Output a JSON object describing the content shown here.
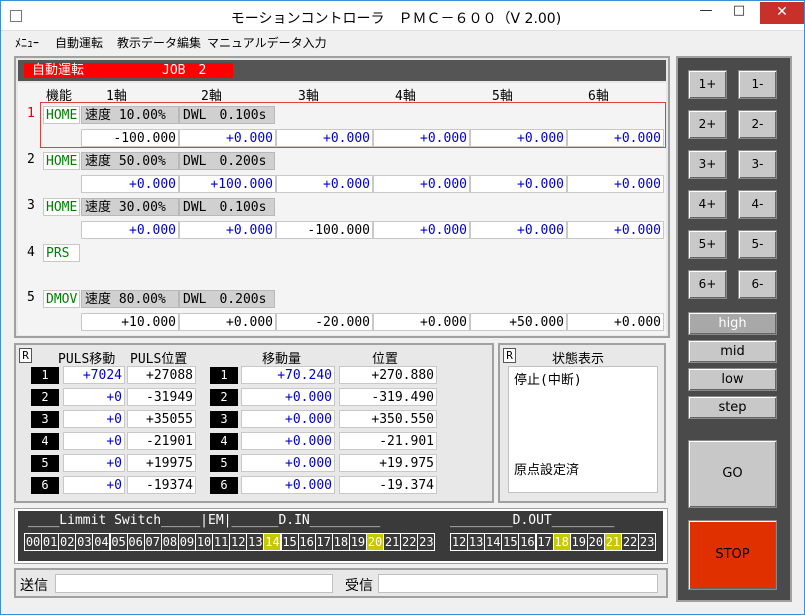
{
  "title": "モーションコントローラ　ＰＭＣ－６００（V 2.00)",
  "titlebar": {
    "minimize": "—",
    "maximize": "□",
    "close": "✕"
  },
  "menu": [
    "ﾒﾆｭｰ",
    "自動運転",
    "教示データ編集",
    "マニュアルデータ入力"
  ],
  "job": {
    "mode": "自動運転",
    "label": "JOB　2"
  },
  "table": {
    "headers": [
      "機能",
      "1軸",
      "2軸",
      "3軸",
      "4軸",
      "5軸",
      "6軸"
    ],
    "rows": [
      {
        "no": "1",
        "kind": "HOME",
        "speed": "速度 10.00%",
        "dwl": "DWL　0.100s",
        "vals": [
          "-100.000",
          "+0.000",
          "+0.000",
          "+0.000",
          "+0.000",
          "+0.000"
        ],
        "selected": true
      },
      {
        "no": "2",
        "kind": "HOME",
        "speed": "速度 50.00%",
        "dwl": "DWL　0.200s",
        "vals": [
          "+0.000",
          "+100.000",
          "+0.000",
          "+0.000",
          "+0.000",
          "+0.000"
        ]
      },
      {
        "no": "3",
        "kind": "HOME",
        "speed": "速度 30.00%",
        "dwl": "DWL　0.100s",
        "vals": [
          "+0.000",
          "+0.000",
          "-100.000",
          "+0.000",
          "+0.000",
          "+0.000"
        ]
      },
      {
        "no": "4",
        "kind": "PRS"
      },
      {
        "no": "5",
        "kind": "DMOV",
        "speed": "速度 80.00%",
        "dwl": "DWL　0.200s",
        "vals": [
          "+10.000",
          "+0.000",
          "-20.000",
          "+0.000",
          "+50.000",
          "+0.000"
        ]
      }
    ]
  },
  "pos": {
    "r": "R",
    "headers": [
      "PULS移動",
      "PULS位置",
      "移動量",
      "位置"
    ],
    "rows": [
      {
        "n": "1",
        "pmove": "+7024",
        "ppos": "+27088",
        "move": "+70.240",
        "pos": "+270.880"
      },
      {
        "n": "2",
        "pmove": "+0",
        "ppos": "-31949",
        "move": "+0.000",
        "pos": "-319.490"
      },
      {
        "n": "3",
        "pmove": "+0",
        "ppos": "+35055",
        "move": "+0.000",
        "pos": "+350.550"
      },
      {
        "n": "4",
        "pmove": "+0",
        "ppos": "-21901",
        "move": "+0.000",
        "pos": "-21.901"
      },
      {
        "n": "5",
        "pmove": "+0",
        "ppos": "+19975",
        "move": "+0.000",
        "pos": "+19.975"
      },
      {
        "n": "6",
        "pmove": "+0",
        "ppos": "-19374",
        "move": "+0.000",
        "pos": "-19.374"
      }
    ]
  },
  "status": {
    "r": "R",
    "title": "状態表示",
    "line1": "停止(中断)",
    "line2": "原点設定済"
  },
  "io": {
    "header_ls": "____Limmit Switch_____|EM|______D.IN_________",
    "header_out": "________D.OUT________",
    "ls_bits": [
      "00",
      "01",
      "02",
      "03",
      "04",
      "05",
      "06",
      "07",
      "08",
      "09",
      "10",
      "11",
      "12",
      "13",
      "14",
      "15",
      "16",
      "17",
      "18",
      "19",
      "20",
      "21",
      "22",
      "23"
    ],
    "ls_on": [
      "14",
      "20"
    ],
    "out_bits": [
      "12",
      "13",
      "14",
      "15",
      "16",
      "17",
      "18",
      "19",
      "20",
      "21",
      "22",
      "23"
    ],
    "out_on": [
      "18",
      "21"
    ],
    "on_color": "#c8c800"
  },
  "comm": {
    "send": "送信",
    "recv": "受信"
  },
  "jog": [
    "1+",
    "1-",
    "2+",
    "2-",
    "3+",
    "3-",
    "4+",
    "4-",
    "5+",
    "5-",
    "6+",
    "6-"
  ],
  "speed": [
    "high",
    "mid",
    "low",
    "step"
  ],
  "speed_selected": "high",
  "go": "GO",
  "stop": "STOP",
  "stop_color": "#e03000"
}
